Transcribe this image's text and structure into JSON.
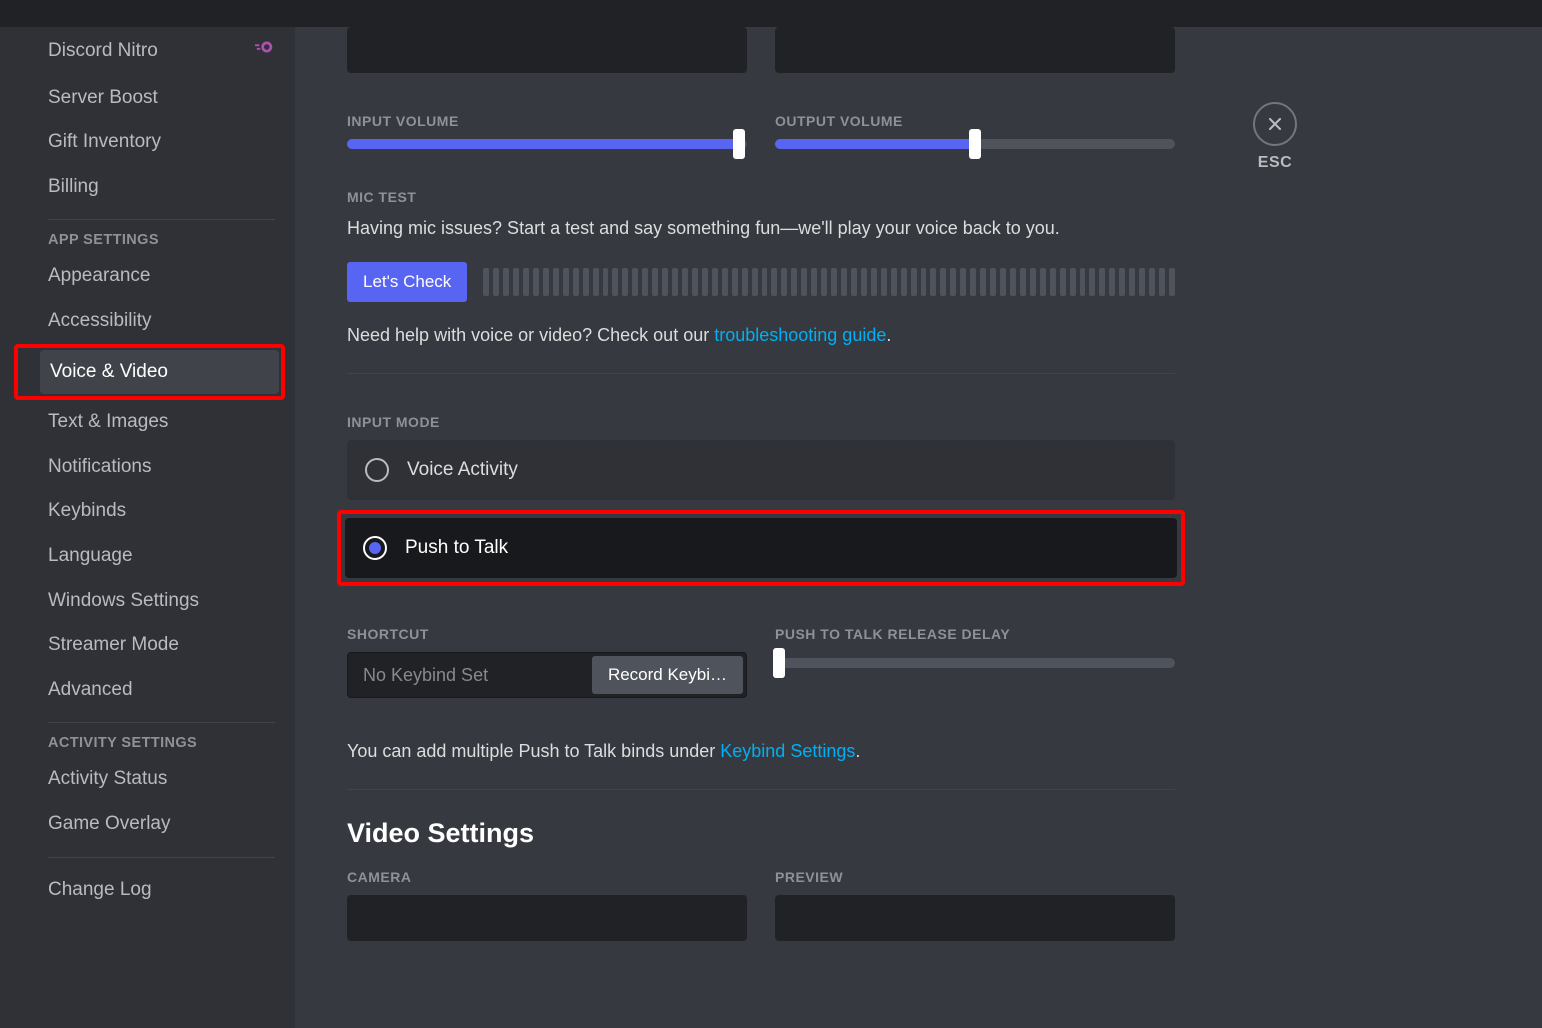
{
  "sidebar": {
    "billing_cat_items": [
      {
        "label": "Discord Nitro",
        "icon": "nitro"
      },
      {
        "label": "Server Boost"
      },
      {
        "label": "Gift Inventory"
      },
      {
        "label": "Billing"
      }
    ],
    "app_settings_label": "APP SETTINGS",
    "app_settings_items": [
      {
        "label": "Appearance"
      },
      {
        "label": "Accessibility"
      },
      {
        "label": "Voice & Video",
        "selected": true,
        "highlight": true
      },
      {
        "label": "Text & Images"
      },
      {
        "label": "Notifications"
      },
      {
        "label": "Keybinds"
      },
      {
        "label": "Language"
      },
      {
        "label": "Windows Settings"
      },
      {
        "label": "Streamer Mode"
      },
      {
        "label": "Advanced"
      }
    ],
    "activity_settings_label": "ACTIVITY SETTINGS",
    "activity_items": [
      {
        "label": "Activity Status"
      },
      {
        "label": "Game Overlay"
      }
    ],
    "change_log_label": "Change Log"
  },
  "close_label": "ESC",
  "input_volume": {
    "label": "INPUT VOLUME",
    "value_pct": 98
  },
  "output_volume": {
    "label": "OUTPUT VOLUME",
    "value_pct": 50
  },
  "mic_test": {
    "label": "MIC TEST",
    "desc": "Having mic issues? Start a test and say something fun—we'll play your voice back to you.",
    "button": "Let's Check"
  },
  "help": {
    "prefix": "Need help with voice or video? Check out our ",
    "link": "troubleshooting guide",
    "suffix": "."
  },
  "input_mode": {
    "label": "INPUT MODE",
    "options": [
      {
        "label": "Voice Activity",
        "selected": false
      },
      {
        "label": "Push to Talk",
        "selected": true,
        "highlight": true
      }
    ]
  },
  "shortcut": {
    "label": "SHORTCUT",
    "placeholder": "No Keybind Set",
    "button": "Record Keybi…"
  },
  "ptt_delay": {
    "label": "PUSH TO TALK RELEASE DELAY",
    "value_pct": 1
  },
  "ptt_hint": {
    "prefix": "You can add multiple Push to Talk binds under ",
    "link": "Keybind Settings",
    "suffix": "."
  },
  "video": {
    "heading": "Video Settings",
    "camera_label": "CAMERA",
    "preview_label": "PREVIEW"
  }
}
